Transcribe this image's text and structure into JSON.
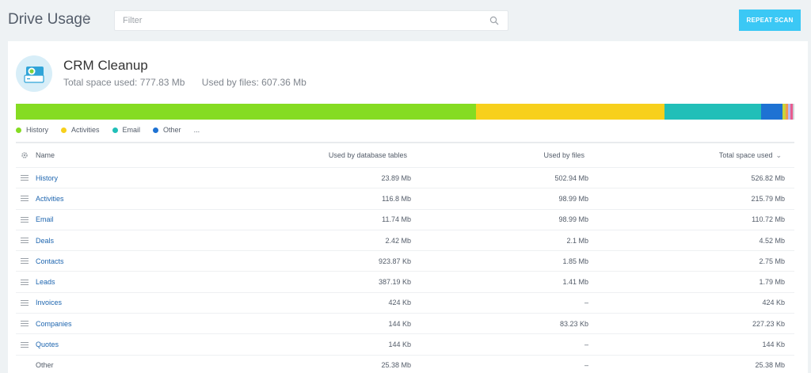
{
  "header": {
    "title": "Drive Usage",
    "filter_placeholder": "Filter",
    "repeat_scan_label": "REPEAT SCAN"
  },
  "summary": {
    "app_name": "CRM Cleanup",
    "total_space_text": "Total space used: 777.83 Mb",
    "files_space_text": "Used by files: 607.36 Mb"
  },
  "usage_bar": [
    {
      "name": "History",
      "color": "#85dc22",
      "share": 0.591
    },
    {
      "name": "Activities",
      "color": "#f7d01c",
      "share": 0.242
    },
    {
      "name": "Email",
      "color": "#21bfb8",
      "share": 0.124
    },
    {
      "name": "Other",
      "color": "#1e72d3",
      "share": 0.028
    },
    {
      "name": "",
      "color": "#c9d33b",
      "share": 0.004
    },
    {
      "name": "",
      "color": "#f29a4d",
      "share": 0.003
    },
    {
      "name": "",
      "color": "#b8b5f0",
      "share": 0.003
    },
    {
      "name": "",
      "color": "#e85c8e",
      "share": 0.003
    },
    {
      "name": "",
      "color": "#cfd4d8",
      "share": 0.002
    }
  ],
  "legend": {
    "items": [
      {
        "label": "History",
        "color": "#85dc22"
      },
      {
        "label": "Activities",
        "color": "#f7d01c"
      },
      {
        "label": "Email",
        "color": "#21bfb8"
      },
      {
        "label": "Other",
        "color": "#1e72d3"
      }
    ],
    "more": "..."
  },
  "table": {
    "columns": {
      "name": "Name",
      "db": "Used by database tables",
      "files": "Used by files",
      "total": "Total space used"
    },
    "rows": [
      {
        "name": "History",
        "db": "23.89 Mb",
        "files": "502.94 Mb",
        "total": "526.82 Mb",
        "link": true
      },
      {
        "name": "Activities",
        "db": "116.8 Mb",
        "files": "98.99 Mb",
        "total": "215.79 Mb",
        "link": true
      },
      {
        "name": "Email",
        "db": "11.74 Mb",
        "files": "98.99 Mb",
        "total": "110.72 Mb",
        "link": true
      },
      {
        "name": "Deals",
        "db": "2.42 Mb",
        "files": "2.1 Mb",
        "total": "4.52 Mb",
        "link": true
      },
      {
        "name": "Contacts",
        "db": "923.87 Kb",
        "files": "1.85 Mb",
        "total": "2.75 Mb",
        "link": true
      },
      {
        "name": "Leads",
        "db": "387.19 Kb",
        "files": "1.41 Mb",
        "total": "1.79 Mb",
        "link": true
      },
      {
        "name": "Invoices",
        "db": "424 Kb",
        "files": "–",
        "total": "424 Kb",
        "link": true
      },
      {
        "name": "Companies",
        "db": "144 Kb",
        "files": "83.23 Kb",
        "total": "227.23 Kb",
        "link": true
      },
      {
        "name": "Quotes",
        "db": "144 Kb",
        "files": "–",
        "total": "144 Kb",
        "link": true
      },
      {
        "name": "Other",
        "db": "25.38 Mb",
        "files": "–",
        "total": "25.38 Mb",
        "link": false
      }
    ]
  }
}
